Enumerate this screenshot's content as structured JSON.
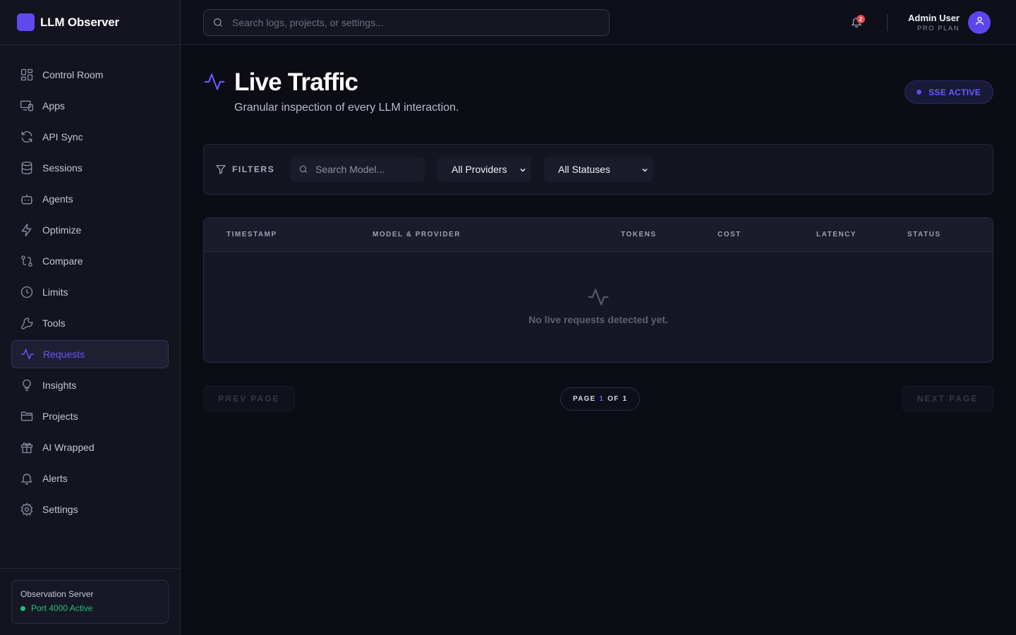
{
  "brand": {
    "name": "LLM Observer"
  },
  "nav": [
    {
      "label": "Control Room",
      "icon": "grid-icon"
    },
    {
      "label": "Apps",
      "icon": "devices-icon"
    },
    {
      "label": "API Sync",
      "icon": "refresh-icon"
    },
    {
      "label": "Sessions",
      "icon": "database-icon"
    },
    {
      "label": "Agents",
      "icon": "bot-icon"
    },
    {
      "label": "Optimize",
      "icon": "bolt-icon"
    },
    {
      "label": "Compare",
      "icon": "git-compare-icon"
    },
    {
      "label": "Limits",
      "icon": "clock-icon"
    },
    {
      "label": "Tools",
      "icon": "wrench-icon"
    },
    {
      "label": "Requests",
      "icon": "activity-icon",
      "active": true
    },
    {
      "label": "Insights",
      "icon": "lightbulb-icon"
    },
    {
      "label": "Projects",
      "icon": "folder-icon"
    },
    {
      "label": "AI Wrapped",
      "icon": "gift-icon"
    },
    {
      "label": "Alerts",
      "icon": "bell-icon"
    },
    {
      "label": "Settings",
      "icon": "gear-icon"
    }
  ],
  "server": {
    "title": "Observation Server",
    "status": "Port 4000 Active",
    "status_color": "#1fbf84"
  },
  "topbar": {
    "search_placeholder": "Search logs, projects, or settings...",
    "notification_count": "2",
    "user_name": "Admin User",
    "user_plan": "PRO PLAN"
  },
  "page": {
    "title": "Live Traffic",
    "subtitle": "Granular inspection of every LLM interaction.",
    "sse_badge": "SSE ACTIVE"
  },
  "filters": {
    "label": "FILTERS",
    "model_placeholder": "Search Model...",
    "provider_value": "All Providers",
    "status_value": "All Statuses"
  },
  "table": {
    "columns": [
      "TIMESTAMP",
      "MODEL & PROVIDER",
      "TOKENS",
      "COST",
      "LATENCY",
      "STATUS"
    ],
    "empty_text": "No live requests detected yet."
  },
  "pager": {
    "prev_label": "PREV PAGE",
    "next_label": "NEXT PAGE",
    "page_word": "PAGE",
    "current": "1",
    "of_word": "OF",
    "total": "1"
  },
  "colors": {
    "accent": "#6a55ff",
    "background": "#0b0c14"
  }
}
